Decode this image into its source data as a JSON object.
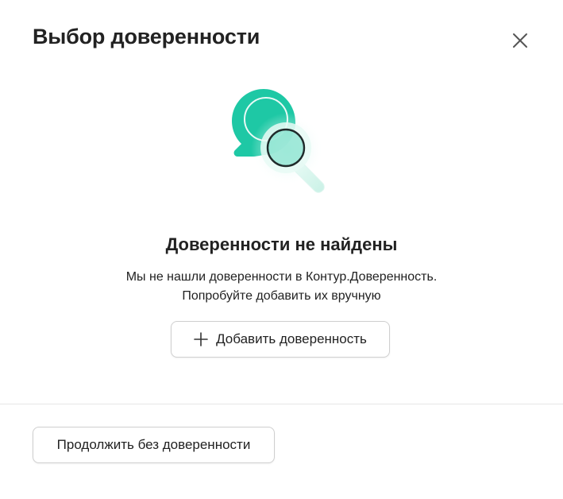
{
  "dialog": {
    "title": "Выбор доверенности",
    "close_icon": "close-icon"
  },
  "empty_state": {
    "illustration_icon": "search-not-found-illustration",
    "title": "Доверенности не найдены",
    "description_line1": "Мы не нашли доверенности в Контур.Доверенность.",
    "description_line2": "Попробуйте добавить их вручную",
    "add_button": {
      "icon": "plus-icon",
      "label": "Добавить доверенность"
    }
  },
  "footer": {
    "continue_button_label": "Продолжить без доверенности"
  },
  "colors": {
    "accent": "#1ec8a5",
    "text": "#222222",
    "border": "#cfcfcf",
    "divider": "#e6e6e6"
  }
}
